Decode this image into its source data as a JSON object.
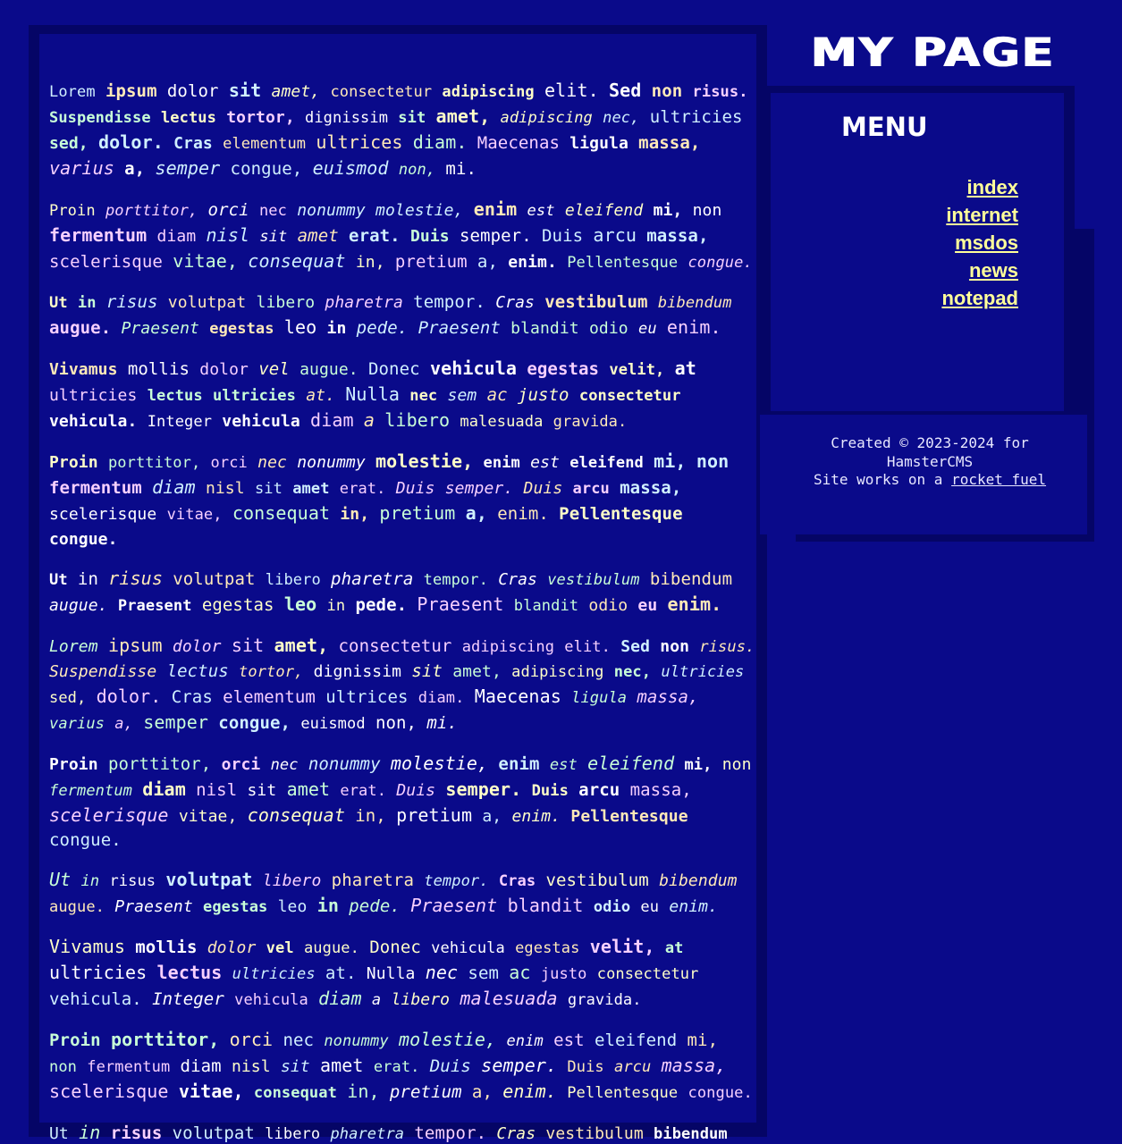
{
  "header": {
    "site_title": "MY PAGE"
  },
  "sidebar": {
    "menu_title": "MENU",
    "items": [
      {
        "label": "index"
      },
      {
        "label": "internet"
      },
      {
        "label": "msdos"
      },
      {
        "label": "news"
      },
      {
        "label": "notepad"
      }
    ]
  },
  "footer": {
    "line1": "Created © 2023-2024 for",
    "line2": "HamsterCMS",
    "line3_prefix": "Site works on a",
    "line3_link": "rocket fuel"
  },
  "main": {
    "paragraphs": [
      "Lorem ipsum dolor sit amet, consectetur adipiscing elit. Sed non risus. Suspendisse lectus tortor, dignissim sit amet, adipiscing nec, ultricies sed, dolor. Cras elementum ultrices diam. Maecenas ligula massa, varius a, semper congue, euismod non, mi.",
      "Proin porttitor, orci nec nonummy molestie, enim est eleifend mi, non fermentum diam nisl sit amet erat. Duis semper. Duis arcu massa, scelerisque vitae, consequat in, pretium a, enim. Pellentesque congue.",
      "Ut in risus volutpat libero pharetra tempor. Cras vestibulum bibendum augue. Praesent egestas leo in pede. Praesent blandit odio eu enim.",
      "Vivamus mollis dolor vel augue. Donec vehicula egestas velit, at ultricies lectus ultricies at. Nulla nec sem ac justo consectetur vehicula. Integer vehicula diam a libero malesuada gravida.",
      "Proin porttitor, orci nec nonummy molestie, enim est eleifend mi, non fermentum diam nisl sit amet erat. Duis semper. Duis arcu massa, scelerisque vitae, consequat in, pretium a, enim. Pellentesque congue.",
      "Ut in risus volutpat libero pharetra tempor. Cras vestibulum bibendum augue. Praesent egestas leo in pede. Praesent blandit odio eu enim.",
      "Lorem ipsum dolor sit amet, consectetur adipiscing elit. Sed non risus. Suspendisse lectus tortor, dignissim sit amet, adipiscing nec, ultricies sed, dolor. Cras elementum ultrices diam. Maecenas ligula massa, varius a, semper congue, euismod non, mi.",
      "Proin porttitor, orci nec nonummy molestie, enim est eleifend mi, non fermentum diam nisl sit amet erat. Duis semper. Duis arcu massa, scelerisque vitae, consequat in, pretium a, enim. Pellentesque congue.",
      "Ut in risus volutpat libero pharetra tempor. Cras vestibulum bibendum augue. Praesent egestas leo in pede. Praesent blandit odio eu enim.",
      "Vivamus mollis dolor vel augue. Donec vehicula egestas velit, at ultricies lectus ultricies at. Nulla nec sem ac justo consectetur vehicula. Integer vehicula diam a libero malesuada gravida.",
      "Proin porttitor, orci nec nonummy molestie, enim est eleifend mi, non fermentum diam nisl sit amet erat. Duis semper. Duis arcu massa, scelerisque vitae, consequat in, pretium a, enim. Pellentesque congue.",
      "Ut in risus volutpat libero pharetra tempor. Cras vestibulum bibendum augue. Praesent egestas leo in pede. Praesent blandit odio eu enim."
    ]
  },
  "colors": {
    "background": "#0a0a8a",
    "panel_shadow": "#050566",
    "link": "#ffff99",
    "text_palette": [
      "#ffffff",
      "#ffe9b8",
      "#d0f0ff",
      "#ffffc8",
      "#f7d0ff",
      "#c8ffd8"
    ]
  }
}
